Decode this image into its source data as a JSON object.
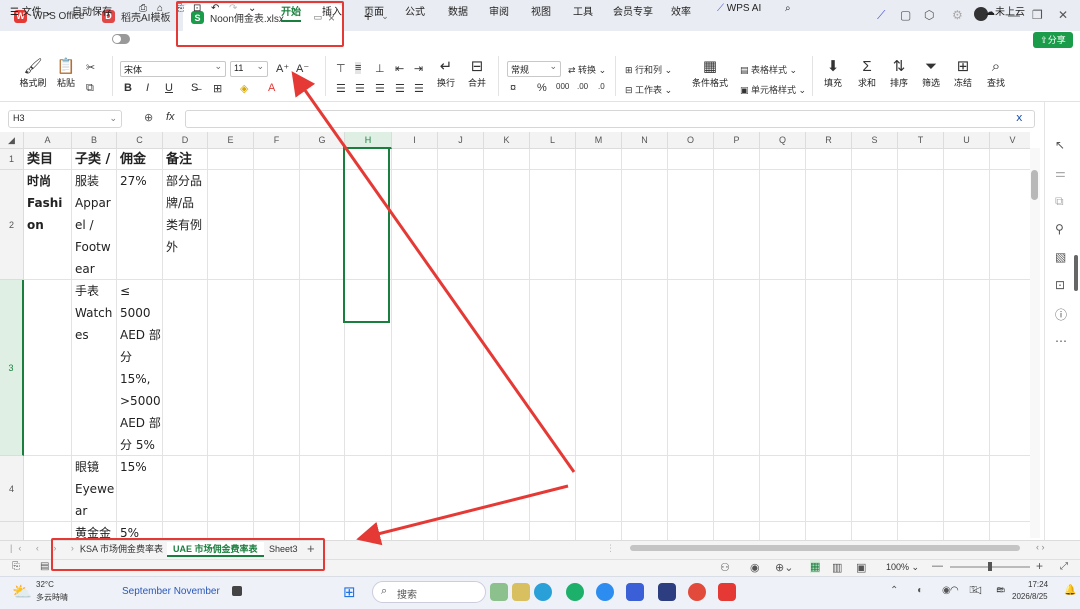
{
  "window": {
    "tabs": [
      {
        "label": "WPS Office",
        "icon": "wps-logo-icon"
      },
      {
        "label": "稻壳AI模板",
        "icon": "docer-icon"
      },
      {
        "label": "Noon佣金表.xlsx",
        "icon": "spreadsheet-icon",
        "active": true
      }
    ],
    "new_tab": "+"
  },
  "menu": {
    "file": "文件",
    "autosave": "自动保存",
    "tabs": [
      "开始",
      "插入",
      "页面",
      "公式",
      "数据",
      "审阅",
      "视图",
      "工具",
      "会员专享",
      "效率"
    ],
    "active_tab": "开始",
    "wps_ai": "WPS AI",
    "cloud": "未上云",
    "share": "分享"
  },
  "ribbon": {
    "format_painter": "格式刷",
    "paste": "粘贴",
    "font_name": "宋体",
    "font_size": "11",
    "wrap": "换行",
    "merge": "合并",
    "number_format": "常规",
    "convert": "转换",
    "rows_cols": "行和列",
    "worksheet": "工作表",
    "cond_format": "条件格式",
    "table_style": "表格样式",
    "cell_style": "单元格样式",
    "fill": "填充",
    "sum": "求和",
    "sort": "排序",
    "filter": "筛选",
    "freeze": "冻结",
    "find": "查找"
  },
  "formula_bar": {
    "cell_ref": "H3",
    "fx": "fx",
    "value": ""
  },
  "columns": [
    "A",
    "B",
    "C",
    "D",
    "E",
    "F",
    "G",
    "H",
    "I",
    "J",
    "K",
    "L",
    "M",
    "N",
    "O",
    "P",
    "Q",
    "R",
    "S",
    "T",
    "U",
    "V"
  ],
  "active_column": "H",
  "rows": [
    "1",
    "2",
    "3",
    "4"
  ],
  "active_row": "3",
  "cells": {
    "A1": "类目",
    "B1": "子类 / 子",
    "C1": "佣金",
    "D1": "备注",
    "A2": "时尚\nFashi\non",
    "B2": "服装\nAppar\nel /\nFootw\near",
    "C2": "27%",
    "D2": "部分品\n牌/品\n类有例\n外",
    "B3": "手表\nWatch\nes",
    "C3": "≤\n5000\nAED 部\n分\n15%,\n>5000\nAED 部\n分 5%",
    "B4": "眼镜\nEyewe\nar",
    "C4": "15%",
    "B5": "黄金金",
    "C5": "5%"
  },
  "sheets": [
    {
      "label": "KSA 市场佣金费率表"
    },
    {
      "label": "UAE 市场佣金费率表",
      "active": true
    },
    {
      "label": "Sheet3"
    }
  ],
  "status": {
    "zoom": "100%"
  },
  "taskbar": {
    "temp": "32°C",
    "weather": "多云時晴",
    "media": "September November",
    "search": "搜索",
    "time": "17:24",
    "date": "2026/8/25"
  },
  "colors": {
    "accent": "#1a7f3e",
    "annotation": "#e53935"
  }
}
